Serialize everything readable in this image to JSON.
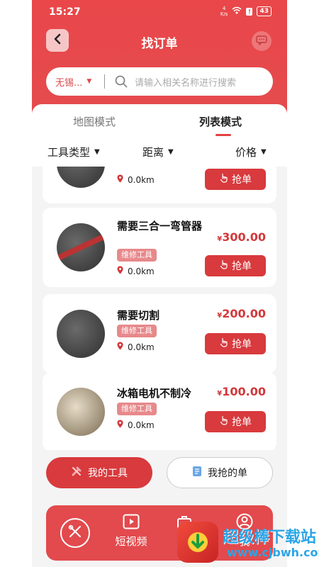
{
  "status_bar": {
    "time": "15:27",
    "speed": "4\nK/s",
    "battery": "43"
  },
  "header": {
    "title": "找订单"
  },
  "search": {
    "city": "无锡...",
    "placeholder": "请输入相关名称进行搜索"
  },
  "modes": {
    "map": "地图模式",
    "list": "列表模式",
    "active": "list"
  },
  "filters": {
    "type": "工具类型",
    "distance": "距离",
    "price": "价格"
  },
  "cards": [
    {
      "title": "",
      "tag": "",
      "distance": "0.0km",
      "price": "",
      "action": "抢单"
    },
    {
      "title": "需要三合一弯管器",
      "tag": "维修工具",
      "distance": "0.0km",
      "currency": "¥",
      "price": "300.00",
      "action": "抢单"
    },
    {
      "title": "需要切割",
      "tag": "维修工具",
      "distance": "0.0km",
      "currency": "¥",
      "price": "200.00",
      "action": "抢单"
    },
    {
      "title": "冰箱电机不制冷",
      "tag": "维修工具",
      "distance": "0.0km",
      "currency": "¥",
      "price": "100.00",
      "action": "抢单"
    }
  ],
  "bottom_buttons": {
    "my_tools": "我的工具",
    "my_grabs": "我抢的单"
  },
  "tabbar": {
    "video": "短视频",
    "tool": "工",
    "me": "我"
  },
  "watermark": {
    "text": "超级棒下载站",
    "url": "www.cjbwh.com"
  },
  "colors": {
    "accent": "#e44b4e",
    "button": "#d83a3d",
    "tag": "#e7898b"
  }
}
